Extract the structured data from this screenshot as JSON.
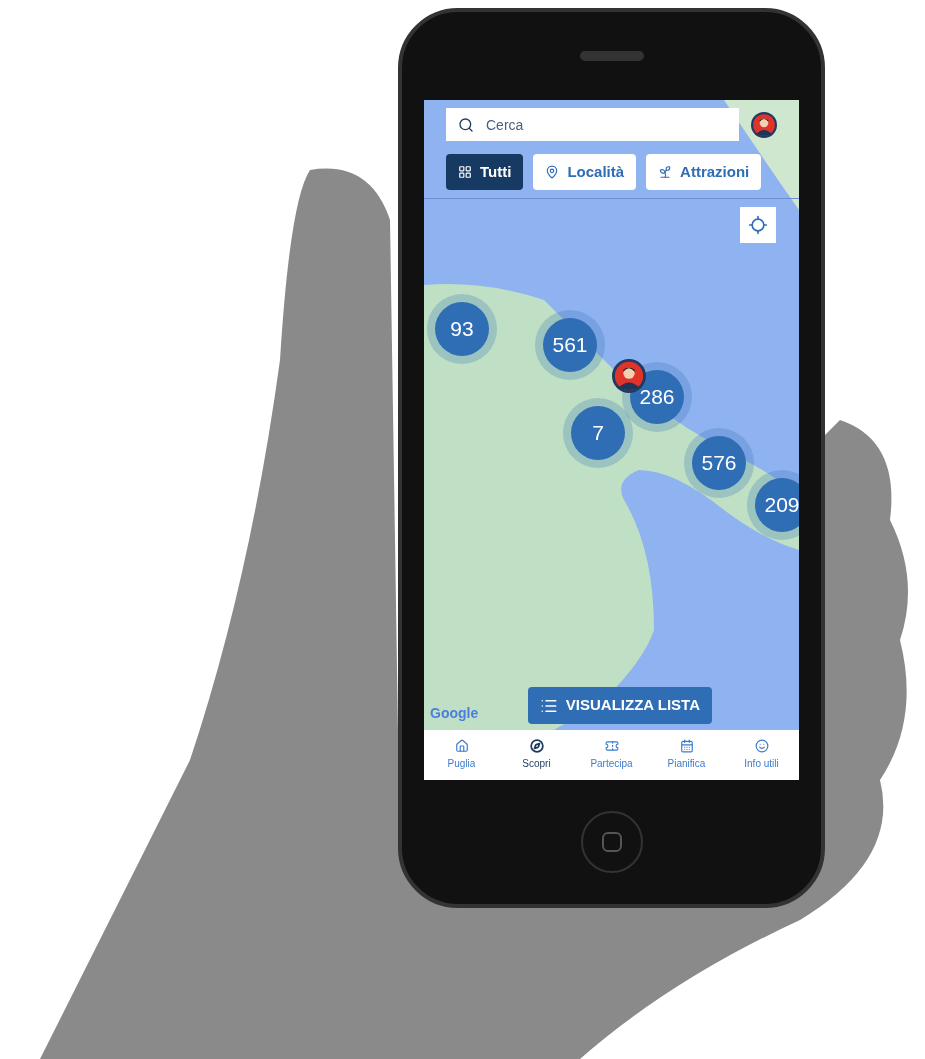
{
  "search": {
    "placeholder": "Cerca"
  },
  "filters": [
    {
      "label": "Tutti",
      "kind": "all",
      "selected": true
    },
    {
      "label": "Località",
      "kind": "place",
      "selected": false
    },
    {
      "label": "Attrazioni",
      "kind": "attraction",
      "selected": false
    }
  ],
  "map": {
    "attribution": "Google",
    "clusters": [
      "93",
      "561",
      "286",
      "7",
      "576",
      "209"
    ]
  },
  "list_button": {
    "label": "VISUALIZZA LISTA"
  },
  "bottom_nav": [
    {
      "label": "Puglia",
      "kind": "home",
      "selected": false
    },
    {
      "label": "Scopri",
      "kind": "compass",
      "selected": true
    },
    {
      "label": "Partecipa",
      "kind": "ticket",
      "selected": false
    },
    {
      "label": "Pianifica",
      "kind": "calendar",
      "selected": false
    },
    {
      "label": "Info utili",
      "kind": "info",
      "selected": false
    }
  ]
}
